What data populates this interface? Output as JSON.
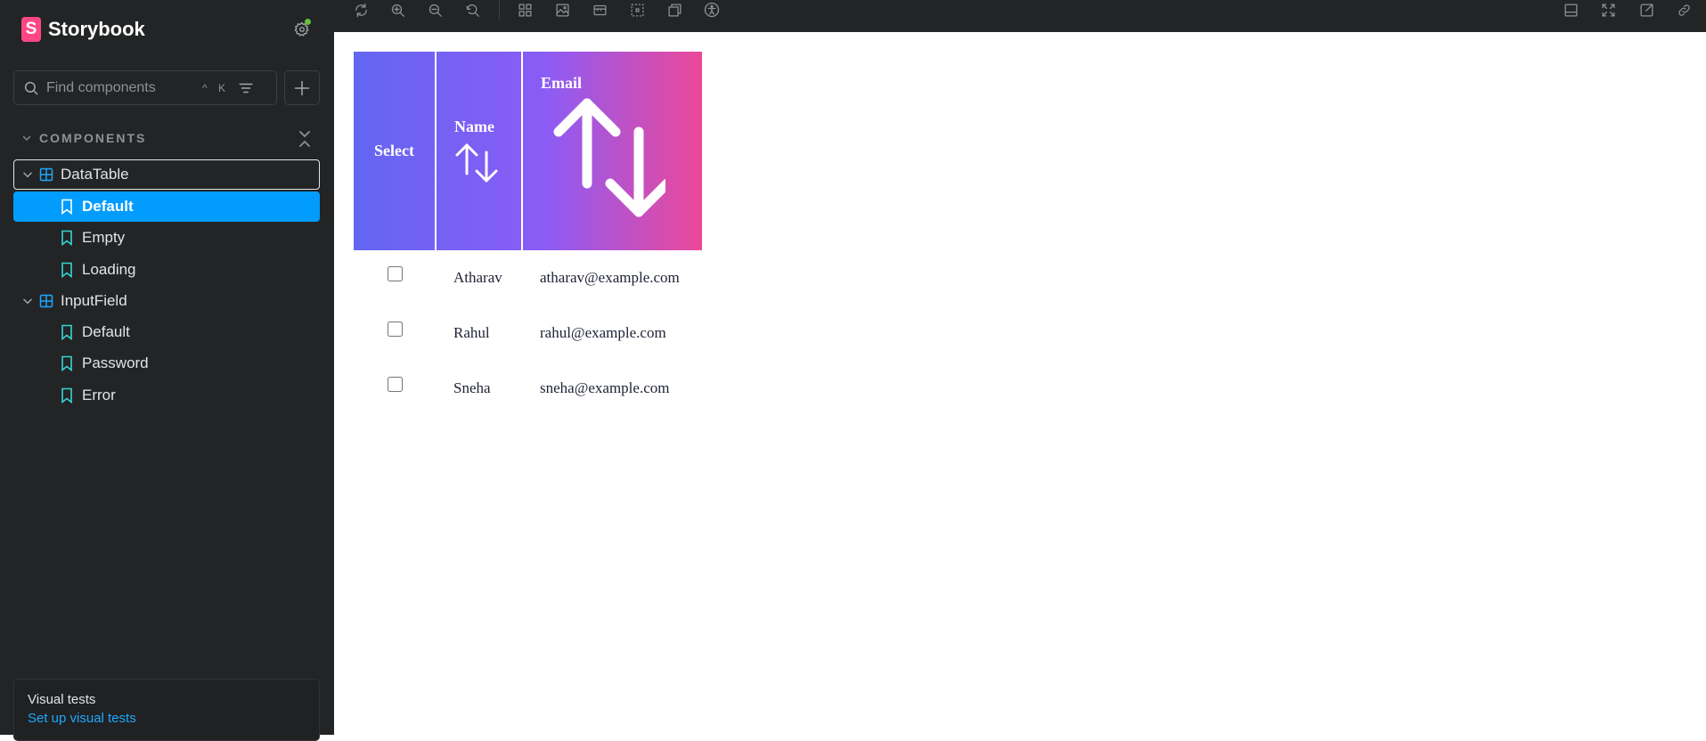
{
  "app": {
    "brand_letter": "S",
    "brand_name": "Storybook"
  },
  "sidebar": {
    "search": {
      "placeholder": "Find components",
      "shortcut_mod": "^",
      "shortcut_key": "K"
    },
    "section_label": "COMPONENTS",
    "tree": [
      {
        "label": "DataTable",
        "expanded": true,
        "focused": true,
        "stories": [
          {
            "label": "Default",
            "selected": true
          },
          {
            "label": "Empty",
            "selected": false
          },
          {
            "label": "Loading",
            "selected": false
          }
        ]
      },
      {
        "label": "InputField",
        "expanded": true,
        "focused": false,
        "stories": [
          {
            "label": "Default",
            "selected": false
          },
          {
            "label": "Password",
            "selected": false
          },
          {
            "label": "Error",
            "selected": false
          }
        ]
      }
    ],
    "visual_tests": {
      "title": "Visual tests",
      "link": "Set up visual tests"
    }
  },
  "toolbar": {
    "left_icons": [
      "reload-icon",
      "zoom-in-icon",
      "zoom-out-icon",
      "zoom-reset-icon",
      "grid-icon",
      "background-image-icon",
      "viewport-icon",
      "outline-icon",
      "measure-icon",
      "accessibility-icon"
    ],
    "right_icons": [
      "bottom-panel-icon",
      "fullscreen-icon",
      "open-new-tab-icon",
      "copy-link-icon"
    ]
  },
  "table": {
    "headers": {
      "select": "Select",
      "name": "Name",
      "email": "Email"
    },
    "rows": [
      {
        "name": "Atharav",
        "email": "atharav@example.com",
        "checked": false
      },
      {
        "name": "Rahul",
        "email": "rahul@example.com",
        "checked": false
      },
      {
        "name": "Sneha",
        "email": "sneha@example.com",
        "checked": false
      }
    ]
  },
  "colors": {
    "sidebar_bg": "#222425",
    "selected_story": "#029cfd",
    "brand_pink": "#ff4785",
    "header_gradient_start": "#6366f1",
    "header_gradient_end": "#ec4899",
    "link_blue": "#1ea7fd",
    "status_dot": "#66bf3c",
    "story_icon": "#37d5d3",
    "component_icon": "#1ea7fd"
  }
}
